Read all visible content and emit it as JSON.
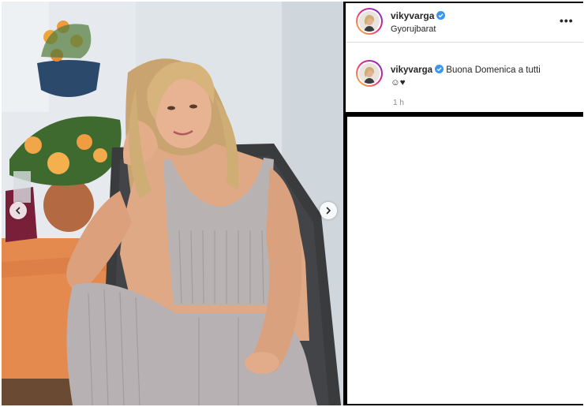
{
  "post": {
    "username": "vikyvarga",
    "location": "Gyorujbarat",
    "more_label": "•••",
    "caption_text": "Buona Domenica a tutti",
    "caption_emoji": "☺︎♥",
    "time_ago": "1 h"
  },
  "icons": {
    "verified": "verified-badge-icon",
    "prev": "chevron-left-icon",
    "next": "chevron-right-icon"
  },
  "colors": {
    "verified": "#3897f0",
    "avatar_ring_start": "#f9ce34",
    "avatar_ring_mid": "#ee2a7b",
    "avatar_ring_end": "#6228d7"
  }
}
